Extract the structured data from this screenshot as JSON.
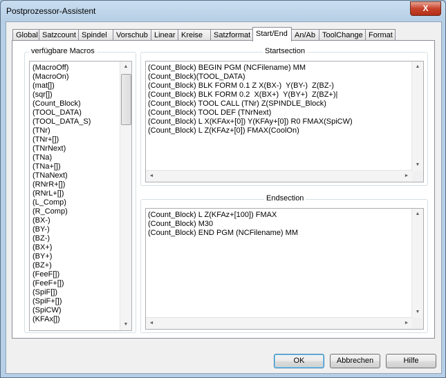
{
  "window": {
    "title": "Postprozessor-Assistent",
    "close_glyph": "X"
  },
  "tabs": [
    {
      "label": "Global"
    },
    {
      "label": "Satzcount"
    },
    {
      "label": "Spindel"
    },
    {
      "label": "Vorschub"
    },
    {
      "label": "Linear"
    },
    {
      "label": "Kreise"
    },
    {
      "label": "Satzformat"
    },
    {
      "label": "Start/End",
      "active": true
    },
    {
      "label": "An/Ab"
    },
    {
      "label": "ToolChange"
    },
    {
      "label": "Format"
    }
  ],
  "macros": {
    "label": "verfügbare Macros",
    "items": [
      "(MacroOff)",
      "(MacroOn)",
      "(mat[])",
      "(sqr[])",
      "(Count_Block)",
      "(TOOL_DATA)",
      "(TOOL_DATA_S)",
      "(TNr)",
      "(TNr+[])",
      "(TNrNext)",
      "(TNa)",
      "(TNa+[])",
      "(TNaNext)",
      "(RNrR+[])",
      "(RNrL+[])",
      "(L_Comp)",
      "(R_Comp)",
      "(BX-)",
      "(BY-)",
      "(BZ-)",
      "(BX+)",
      "(BY+)",
      "(BZ+)",
      "(FeeF[])",
      "(FeeF+[])",
      "(SpiF[])",
      "(SpiF+[])",
      "(SpiCW)",
      "(KFAx[])"
    ]
  },
  "startsection": {
    "label": "Startsection",
    "lines": [
      "(Count_Block) BEGIN PGM (NCFilename) MM",
      "(Count_Block)(TOOL_DATA)",
      "(Count_Block) BLK FORM 0.1 Z X(BX-)  Y(BY-)  Z(BZ-)",
      "(Count_Block) BLK FORM 0.2  X(BX+)  Y(BY+)  Z(BZ+)|",
      "(Count_Block) TOOL CALL (TNr) Z(SPINDLE_Block)",
      "(Count_Block) TOOL DEF (TNrNext)",
      "(Count_Block) L X(KFAx+[0]) Y(KFAy+[0]) R0 FMAX(SpiCW)",
      "(Count_Block) L Z(KFAz+[0]) FMAX(CoolOn)"
    ]
  },
  "endsection": {
    "label": "Endsection",
    "lines": [
      "(Count_Block) L Z(KFAz+[100]) FMAX",
      "(Count_Block) M30",
      "(Count_Block) END PGM (NCFilename) MM"
    ]
  },
  "buttons": {
    "ok": "OK",
    "cancel": "Abbrechen",
    "help": "Hilfe"
  },
  "scroll_glyphs": {
    "up": "▲",
    "down": "▼",
    "left": "◄",
    "right": "►"
  }
}
